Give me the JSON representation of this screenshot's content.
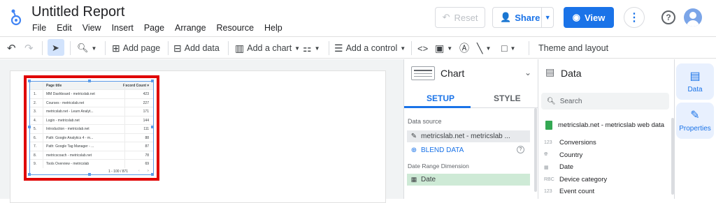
{
  "app": {
    "title": "Untitled Report"
  },
  "menu": [
    "File",
    "Edit",
    "View",
    "Insert",
    "Page",
    "Arrange",
    "Resource",
    "Help"
  ],
  "header": {
    "reset_label": "Reset",
    "share_label": "Share",
    "view_label": "View",
    "help_label": "?"
  },
  "toolbar": {
    "add_page": "Add page",
    "add_data": "Add data",
    "add_chart": "Add a chart",
    "add_control": "Add a control",
    "theme": "Theme and layout"
  },
  "table": {
    "col_page": "Page title",
    "col_count": "Record Count",
    "rows": [
      {
        "n": "1.",
        "title": "MM Dashboard - metricslab.net",
        "count": "423"
      },
      {
        "n": "2.",
        "title": "Courses - metricslab.net",
        "count": "227"
      },
      {
        "n": "3.",
        "title": "metricslab.net - Learn Analyt...",
        "count": "171"
      },
      {
        "n": "4.",
        "title": "Login - metricslab.net",
        "count": "144"
      },
      {
        "n": "5.",
        "title": "Introduction - metricslab.net",
        "count": "111"
      },
      {
        "n": "6.",
        "title": "Path: Google Analytics 4 - m...",
        "count": "88"
      },
      {
        "n": "7.",
        "title": "Path: Google Tag Manager - ...",
        "count": "87"
      },
      {
        "n": "8.",
        "title": "metricscoach - metricslab.net",
        "count": "78"
      },
      {
        "n": "9.",
        "title": "Tools Overview - metricslab",
        "count": "69"
      }
    ],
    "pagination": "1 - 100 / 871"
  },
  "chart_panel": {
    "title": "Chart",
    "tab_setup": "SETUP",
    "tab_style": "STYLE",
    "data_source_label": "Data source",
    "data_source_value": "metricslab.net - metricslab ...",
    "blend": "BLEND DATA",
    "date_range_label": "Date Range Dimension",
    "date_value": "Date"
  },
  "data_panel": {
    "title": "Data",
    "search_placeholder": "Search",
    "source": "metricslab.net - metricslab web data",
    "fields": [
      {
        "type": "123",
        "name": "Conversions"
      },
      {
        "type": "globe",
        "name": "Country"
      },
      {
        "type": "cal",
        "name": "Date"
      },
      {
        "type": "RBC",
        "name": "Device category"
      },
      {
        "type": "123",
        "name": "Event count"
      }
    ]
  },
  "rail": {
    "data": "Data",
    "properties": "Properties"
  },
  "colors": {
    "accent": "#1a73e8",
    "highlight": "#e00000",
    "selected_bg": "#e8f0fe"
  }
}
